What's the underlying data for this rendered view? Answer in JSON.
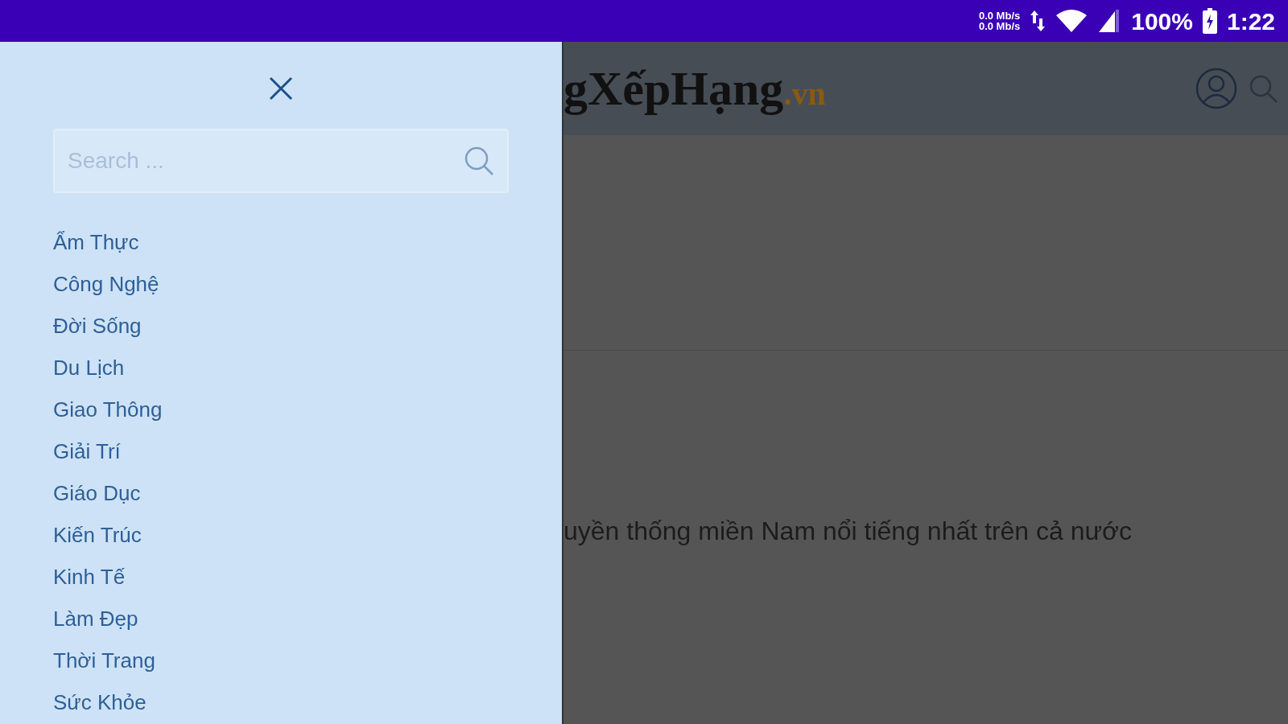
{
  "status_bar": {
    "upload": "0.0 Mb/s",
    "download": "0.0 Mb/s",
    "battery": "100%",
    "time": "1:22"
  },
  "drawer": {
    "search": {
      "placeholder": "Search ..."
    },
    "categories": [
      "Ẩm Thực",
      "Công Nghệ",
      "Đời Sống",
      "Du Lịch",
      "Giao Thông",
      "Giải Trí",
      "Giáo Dục",
      "Kiến Trúc",
      "Kinh Tế",
      "Làm Đẹp",
      "Thời Trang",
      "Sức Khỏe"
    ]
  },
  "header": {
    "logo": "gXếpHạng",
    "logo_suffix": ".vn"
  },
  "content": {
    "headline": "uyền thống miền Nam nổi tiếng nhất trên cả nước"
  }
}
